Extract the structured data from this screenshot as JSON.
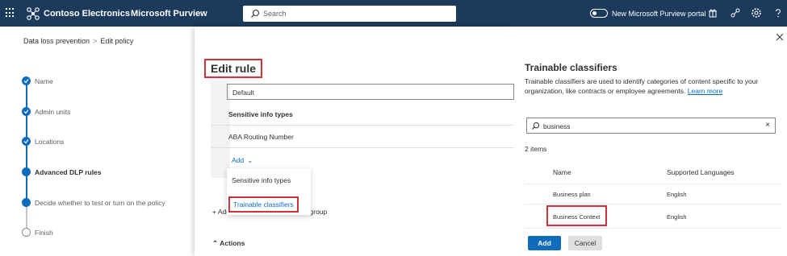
{
  "topbar": {
    "brand": "Contoso Electronics",
    "product": "Microsoft Purview",
    "search_placeholder": "Search",
    "toggle_label": "New Microsoft Purview portal",
    "icons": [
      "app-launcher-icon",
      "gift-icon",
      "share-icon",
      "settings-icon",
      "help-icon"
    ]
  },
  "breadcrumb": {
    "items": [
      "Data loss prevention",
      "Edit policy"
    ],
    "separator": ">"
  },
  "steps": [
    {
      "label": "Name",
      "state": "complete"
    },
    {
      "label": "Admin units",
      "state": "complete"
    },
    {
      "label": "Locations",
      "state": "complete"
    },
    {
      "label": "Advanced DLP rules",
      "state": "current"
    },
    {
      "label": "Decide whether to test or turn on the policy",
      "state": "pending"
    },
    {
      "label": "Finish",
      "state": "empty"
    }
  ],
  "edit_rule": {
    "title": "Edit rule",
    "default_value": "Default",
    "sit_header": "Sensitive info types",
    "sit_items": [
      "ABA Routing Number"
    ],
    "add_label": "Add",
    "add_menu": [
      "Sensitive info types",
      "Trainable classifiers"
    ],
    "add_condition": "Add condition",
    "add_group": "Add group",
    "actions_header": "Actions"
  },
  "flyout": {
    "title": "Trainable classifiers",
    "description": "Trainable classifiers are used to identify categories of content specific to your organization, like contracts or employee agreements.",
    "learn_more": "Learn more",
    "search_value": "business",
    "count": "2 items",
    "columns": [
      "Name",
      "Supported Languages"
    ],
    "rows": [
      {
        "name": "Business plan",
        "language": "English"
      },
      {
        "name": "Business Context",
        "language": "English"
      }
    ],
    "primary_button": "Add",
    "secondary_button": "Cancel"
  },
  "colors": {
    "topbar": "#1b3a5c",
    "accent": "#0f6cbd",
    "highlight": "#d13438"
  }
}
